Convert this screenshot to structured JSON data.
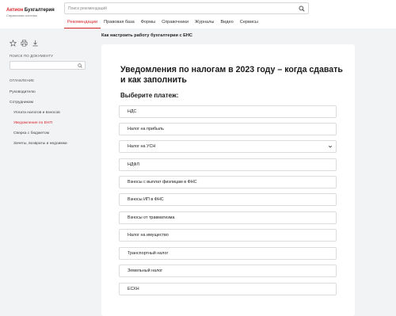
{
  "header": {
    "logo_brand": "Актион",
    "logo_name": " Бухгалтерия",
    "logo_subtitle": "Справочная система",
    "search_placeholder": "Поиск рекомендаций",
    "nav": [
      "Рекомендации",
      "Правовая база",
      "Формы",
      "Справочники",
      "Журналы",
      "Видео",
      "Сервисы"
    ],
    "nav_active": "Рекомендации"
  },
  "breadcrumb": "Как настроить работу бухгалтерии с ЕНС",
  "sidebar": {
    "tools": [
      "star-icon",
      "print-icon",
      "download-icon"
    ],
    "search_label": "ПОИСК ПО ДОКУМЕНТУ",
    "toc_label": "ОГЛАВЛЕНИЕ",
    "toc": [
      {
        "label": "Руководителю"
      },
      {
        "label": "Сотрудникам"
      },
      {
        "label": "Уплата налогов и взносов"
      },
      {
        "label": "Уведомления по ЕНП"
      },
      {
        "label": "Сверка с бюджетом"
      },
      {
        "label": "Зачеты, возвраты и недоимки"
      }
    ]
  },
  "main": {
    "title": "Уведомления по налогам в 2023 году – когда сдавать и как заполнить",
    "subtitle": "Выберите платеж:",
    "payments": [
      "НДС",
      "Налог на прибыль",
      "Налог на УСН",
      "НДФЛ",
      "Взносы с выплат физлицам в ФНС",
      "Взносы ИП в ФНС",
      "Взносы от травматизма",
      "Налог на имущество",
      "Транспортный налог",
      "Земельный налог",
      "ЕСХН"
    ]
  },
  "colors": {
    "accent": "#d8232a",
    "background": "#f2f3f5"
  }
}
